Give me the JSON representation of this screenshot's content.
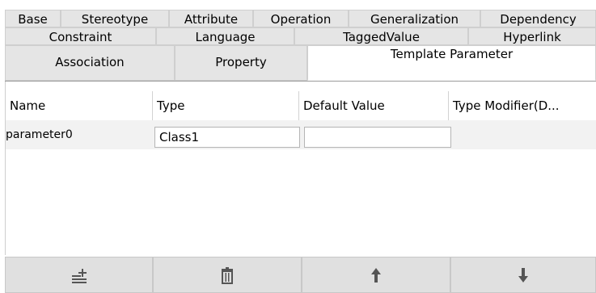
{
  "tabs": {
    "row1": [
      "Base",
      "Stereotype",
      "Attribute",
      "Operation",
      "Generalization",
      "Dependency"
    ],
    "row2": [
      "Constraint",
      "Language",
      "TaggedValue",
      "Hyperlink"
    ],
    "row3": [
      "Association",
      "Property",
      "Template Parameter"
    ],
    "selected": "Template Parameter"
  },
  "table": {
    "columns": [
      "Name",
      "Type",
      "Default Value",
      "Type Modifier(D..."
    ],
    "rows": [
      {
        "name": "parameter0",
        "type": "Class1",
        "default_value": "",
        "type_modifier": ""
      }
    ]
  },
  "buttons": [
    {
      "name": "add-parameter-button",
      "icon": "add-row-icon"
    },
    {
      "name": "delete-parameter-button",
      "icon": "trash-icon"
    },
    {
      "name": "move-up-button",
      "icon": "arrow-up-icon"
    },
    {
      "name": "move-down-button",
      "icon": "arrow-down-icon"
    }
  ],
  "colors": {
    "tab_bg": "#e5e5e5",
    "tab_selected_bg": "#ffffff",
    "row_bg": "#f2f2f2",
    "button_bg": "#e0e0e0",
    "icon": "#555555"
  }
}
